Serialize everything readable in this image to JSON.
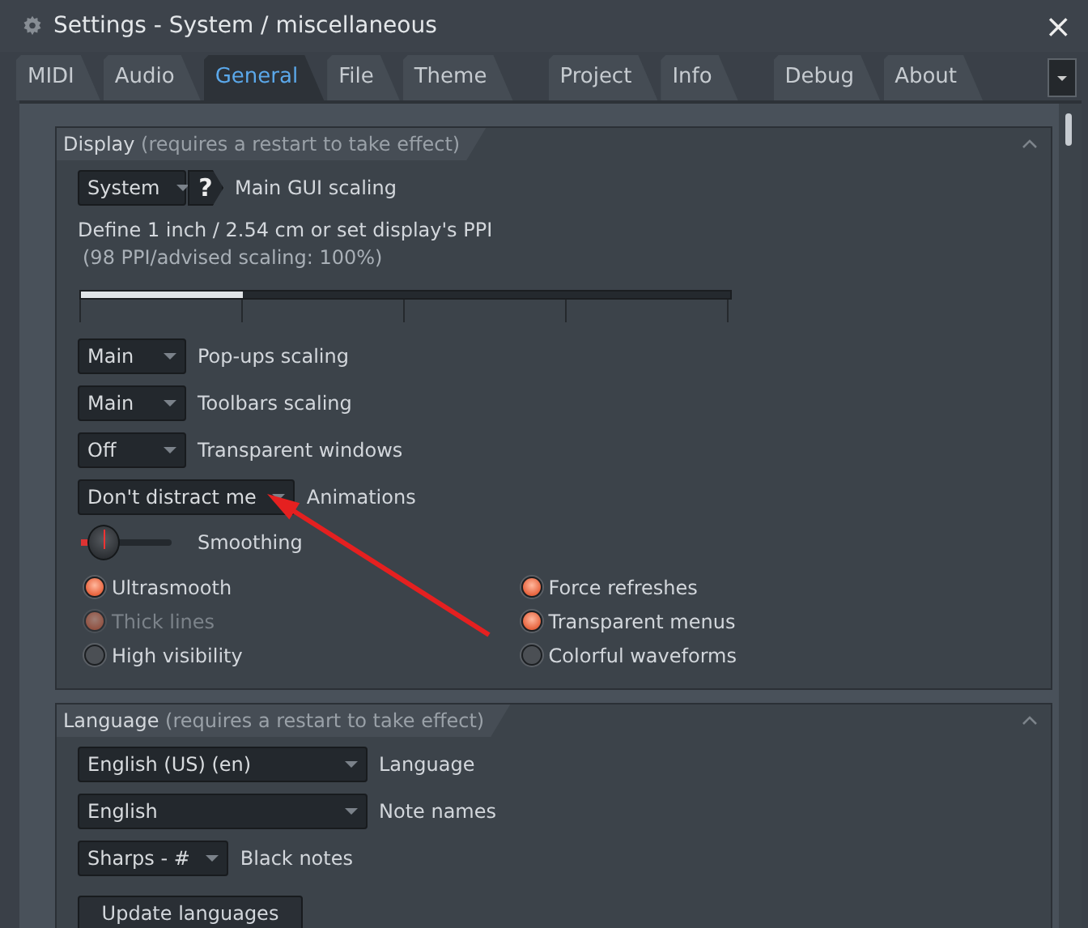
{
  "window": {
    "title": "Settings - System / miscellaneous",
    "close": "×"
  },
  "tab_groups": [
    [
      {
        "label": "MIDI",
        "selected": false
      },
      {
        "label": "Audio",
        "selected": false
      },
      {
        "label": "General",
        "selected": true
      },
      {
        "label": "File",
        "selected": false
      },
      {
        "label": "Theme",
        "selected": false
      }
    ],
    [
      {
        "label": "Project",
        "selected": false
      },
      {
        "label": "Info",
        "selected": false
      }
    ],
    [
      {
        "label": "Debug",
        "selected": false
      },
      {
        "label": "About",
        "selected": false
      }
    ]
  ],
  "display": {
    "title": "Display",
    "note": "(requires a restart to take effect)",
    "expanded": true,
    "gui_scaling": {
      "value": "System",
      "help": "?",
      "label": "Main GUI scaling"
    },
    "ppi_text": "Define 1 inch / 2.54 cm or set display's PPI",
    "ppi_note": "(98 PPI/advised scaling: 100%)",
    "ppi_slider": {
      "level": 0.25
    },
    "combos": [
      {
        "value": "Main",
        "label": "Pop-ups scaling",
        "kind": "narrow"
      },
      {
        "value": "Main",
        "label": "Toolbars scaling",
        "kind": "narrow"
      },
      {
        "value": "Off",
        "label": "Transparent windows",
        "kind": "narrow"
      },
      {
        "value": "Don't distract me",
        "label": "Animations",
        "kind": "fit"
      }
    ],
    "smoothing": {
      "label": "Smoothing"
    },
    "options_left": [
      {
        "label": "Ultrasmooth",
        "selected": true,
        "disabled": false
      },
      {
        "label": "Thick lines",
        "selected": true,
        "disabled": true
      },
      {
        "label": "High visibility",
        "selected": false,
        "disabled": false
      }
    ],
    "options_right": [
      {
        "label": "Force refreshes",
        "selected": true,
        "disabled": false
      },
      {
        "label": "Transparent menus",
        "selected": true,
        "disabled": false
      },
      {
        "label": "Colorful waveforms",
        "selected": false,
        "disabled": false
      }
    ]
  },
  "language": {
    "title": "Language",
    "note": "(requires a restart to take effect)",
    "expanded": true,
    "combos": [
      {
        "value": "English (US) (en)",
        "label": "Language",
        "kind": "wide"
      },
      {
        "value": "English",
        "label": "Note names",
        "kind": "wide"
      },
      {
        "value": "Sharps  - #",
        "label": "Black notes",
        "kind": "fit"
      }
    ],
    "button": "Update languages"
  }
}
